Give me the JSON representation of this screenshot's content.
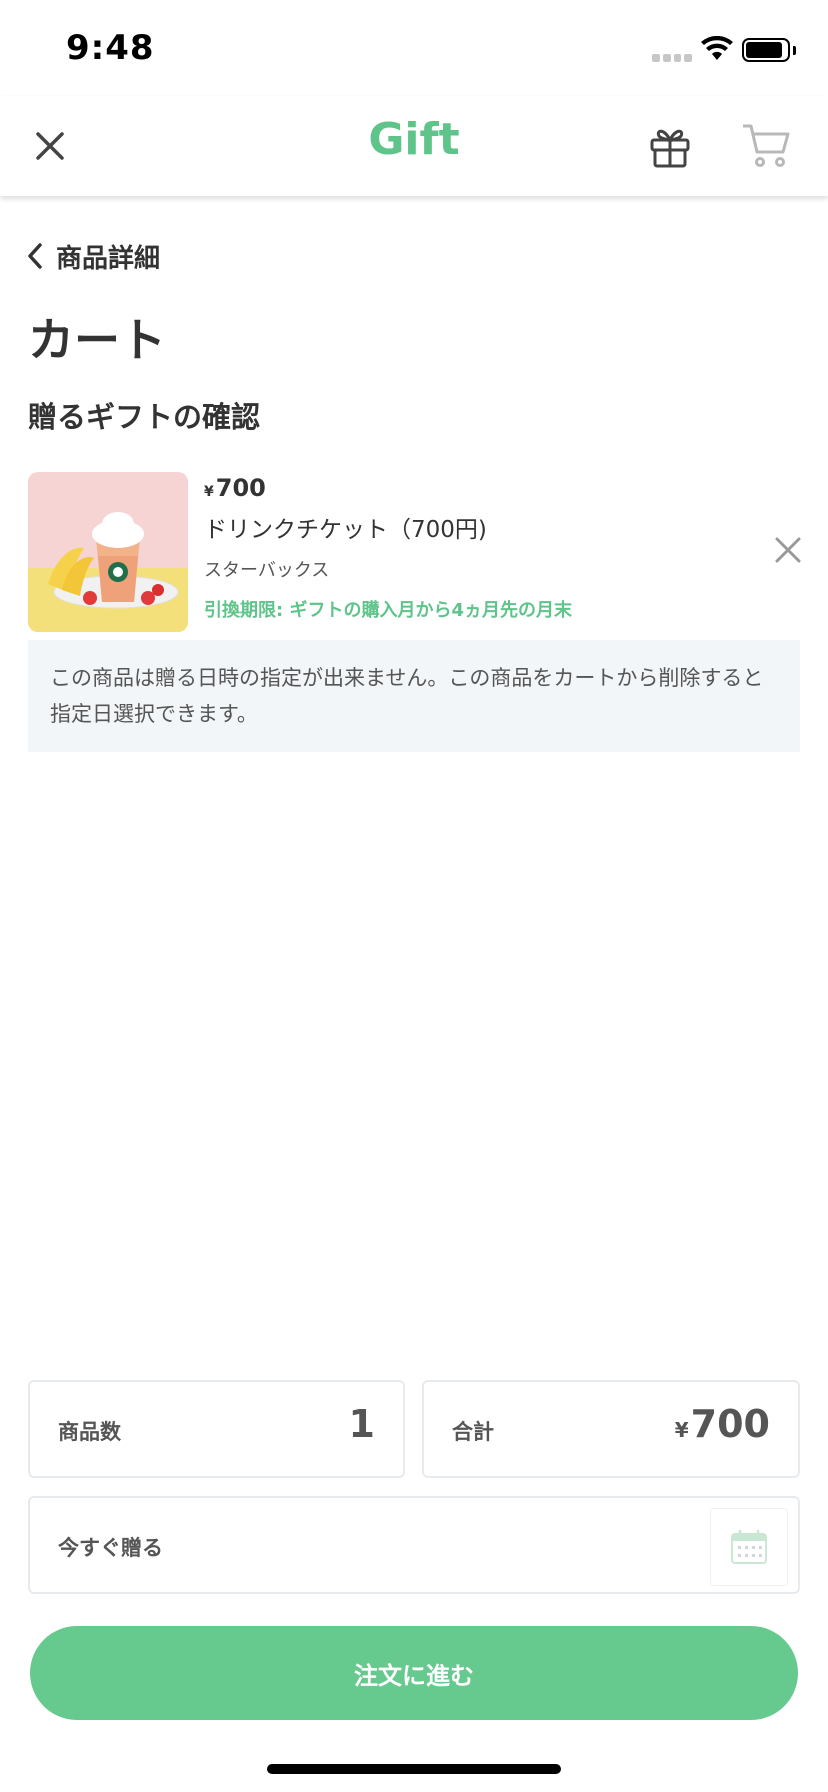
{
  "status_bar": {
    "time": "9:48"
  },
  "nav": {
    "title": "Gift"
  },
  "back": {
    "label": "商品詳細"
  },
  "page": {
    "title": "カート",
    "section_title": "贈るギフトの確認"
  },
  "product": {
    "price_symbol": "¥",
    "price": "700",
    "name": "ドリンクチケット（700円)",
    "brand": "スターバックス",
    "expiry": "引換期限: ギフトの購入月から4ヵ月先の月末"
  },
  "notice": {
    "text": "この商品は贈る日時の指定が出来ません。この商品をカートから削除すると指定日選択できます。"
  },
  "summary": {
    "count_label": "商品数",
    "count_value": "1",
    "total_label": "合計",
    "total_symbol": "¥",
    "total_value": "700"
  },
  "send": {
    "label": "今すぐ贈る"
  },
  "order_button": {
    "label": "注文に進む"
  },
  "colors": {
    "accent": "#5fc48a",
    "button": "#66c98d",
    "notice_bg": "#f3f6f9"
  },
  "icons": [
    "close-icon",
    "gift-icon",
    "cart-icon",
    "chevron-left-icon",
    "remove-icon",
    "calendar-icon",
    "wifi-icon",
    "battery-icon"
  ]
}
